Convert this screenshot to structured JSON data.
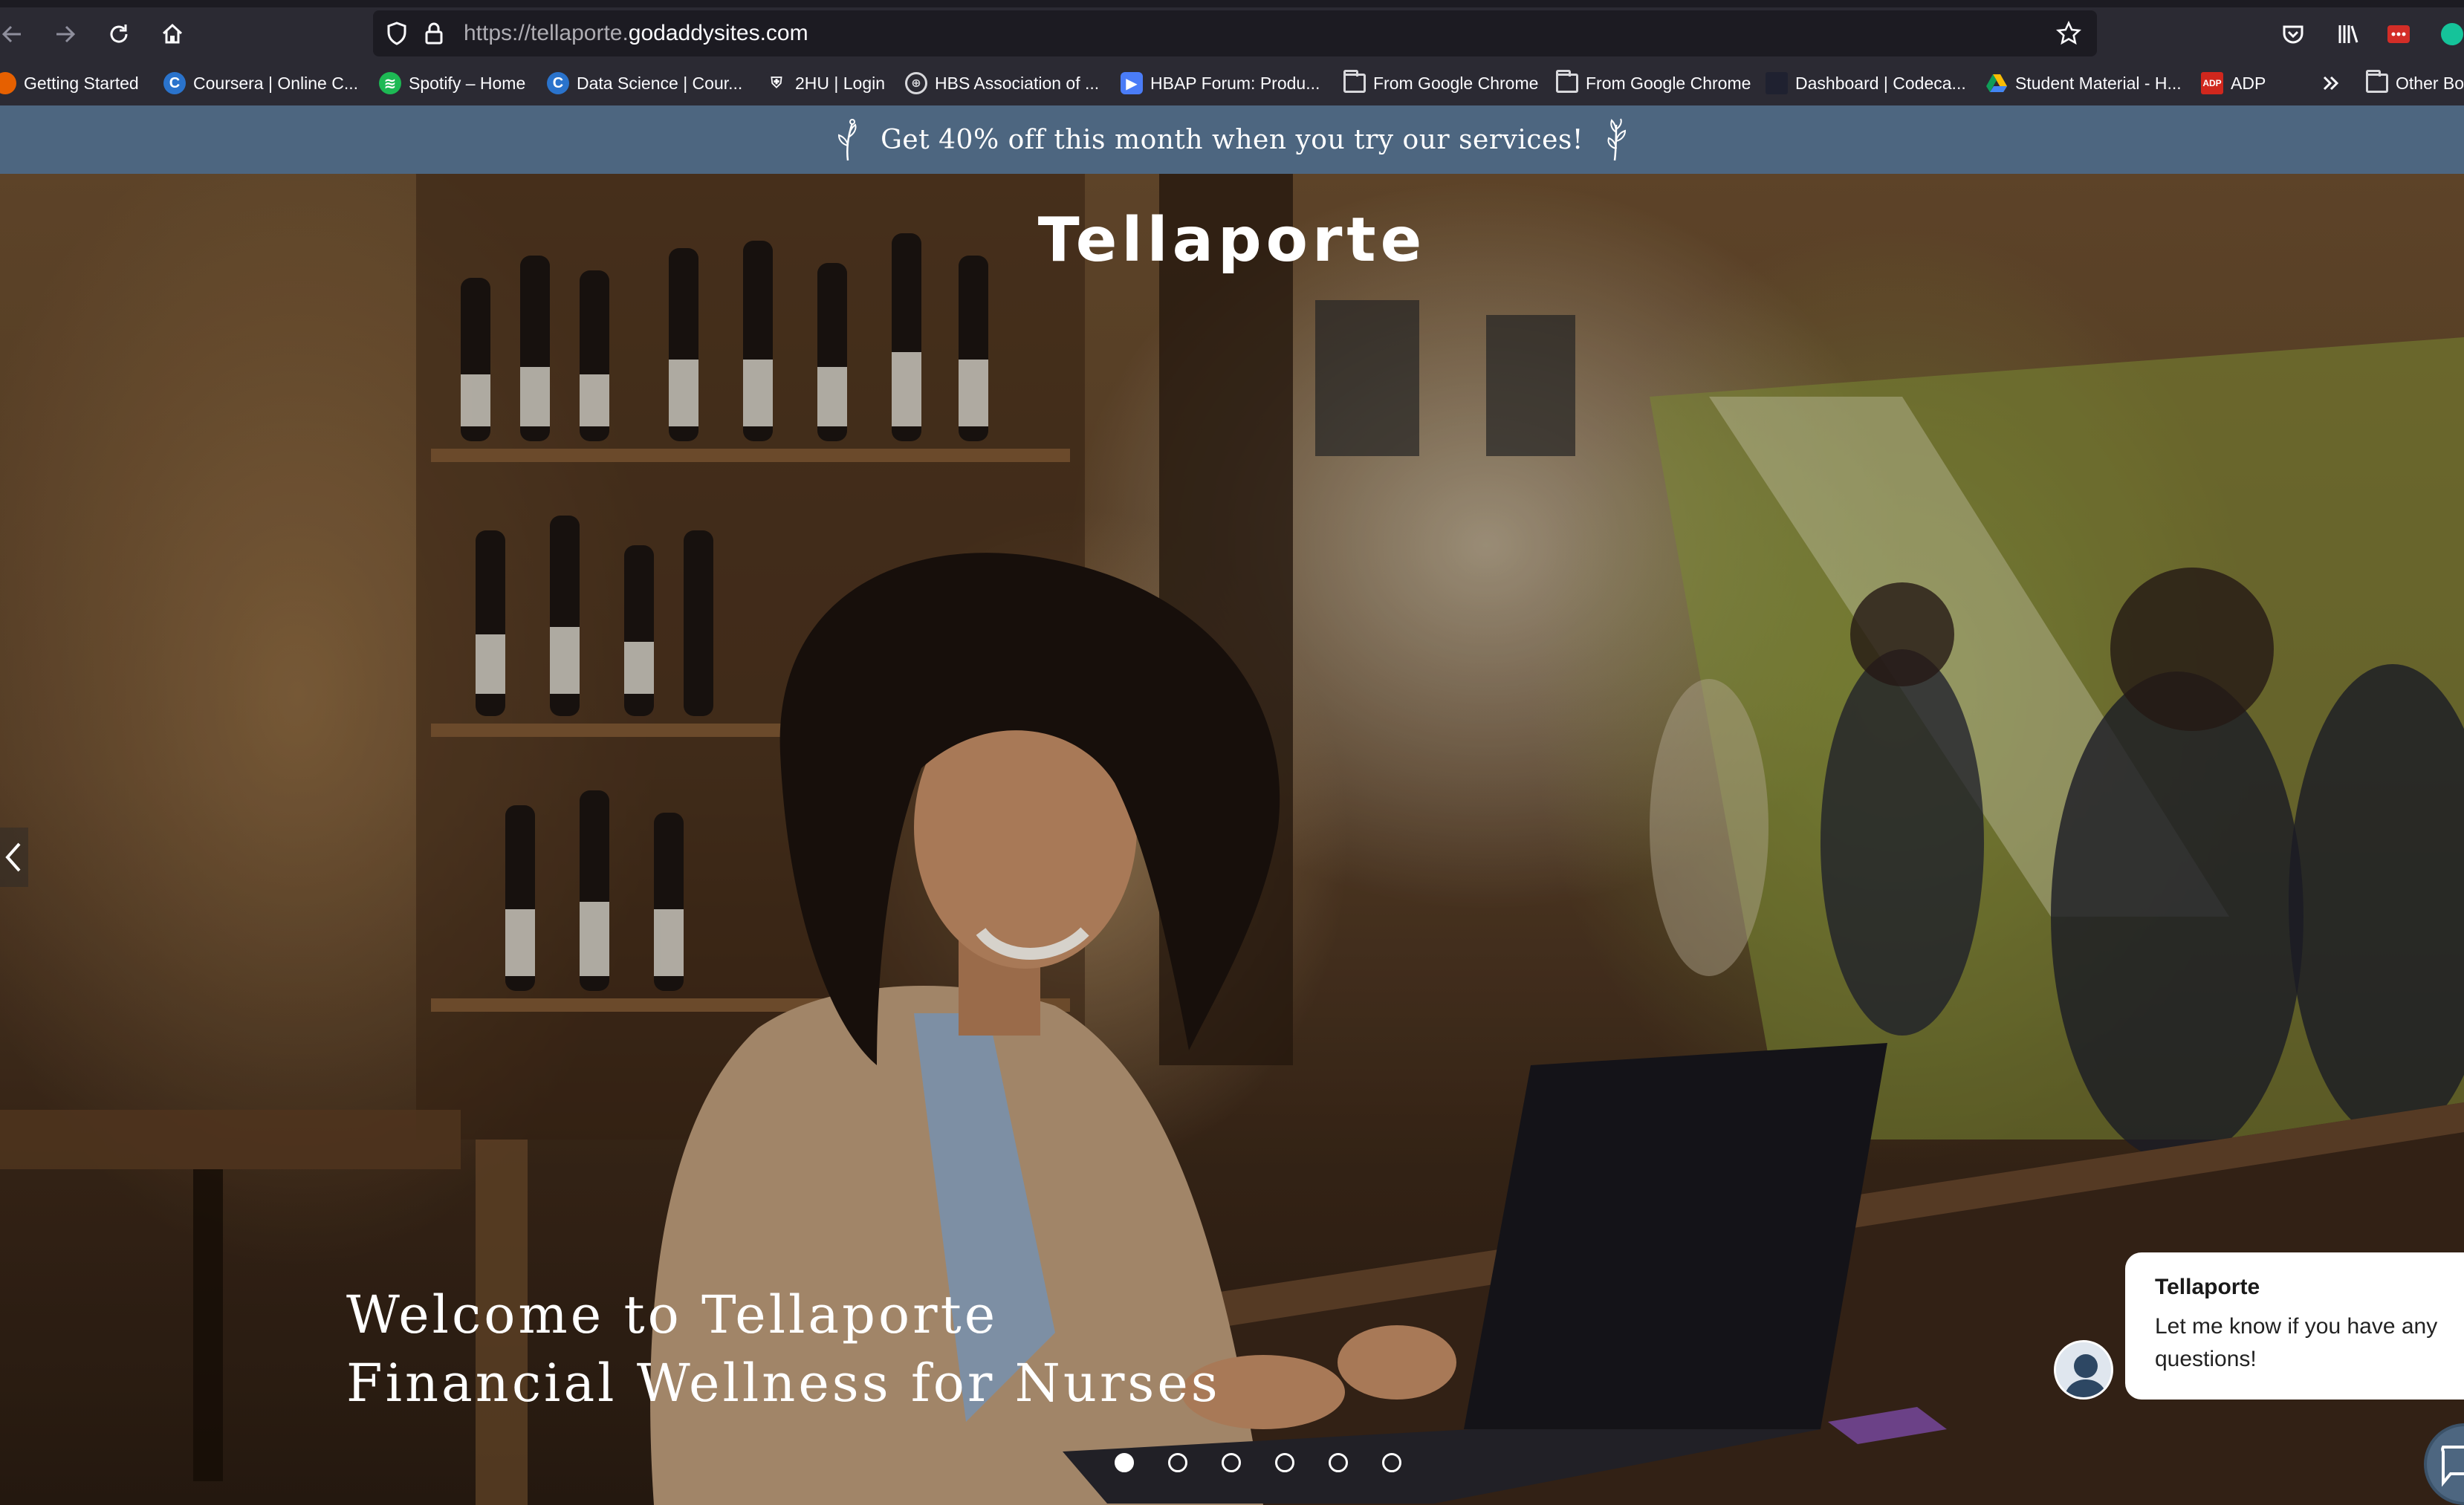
{
  "browser": {
    "url_prefix": "https://tellaporte.",
    "url_domain": "godaddysites.com",
    "bookmarks": [
      {
        "label": "Getting Started",
        "icon": "firefox-icon"
      },
      {
        "label": "Coursera | Online C...",
        "icon": "coursera-icon"
      },
      {
        "label": "Spotify – Home",
        "icon": "spotify-icon"
      },
      {
        "label": "Data Science | Cour...",
        "icon": "coursera-icon"
      },
      {
        "label": "2HU | Login",
        "icon": "harvard-shield-icon"
      },
      {
        "label": "HBS Association of ...",
        "icon": "globe-icon"
      },
      {
        "label": "HBAP Forum: Produ...",
        "icon": "zoom-icon"
      },
      {
        "label": "From Google Chrome",
        "icon": "folder-icon"
      },
      {
        "label": "From Google Chrome",
        "icon": "folder-icon"
      },
      {
        "label": "Dashboard | Codeca...",
        "icon": "codecademy-icon"
      },
      {
        "label": "Student Material - H...",
        "icon": "google-drive-icon"
      },
      {
        "label": "ADP",
        "icon": "adp-icon"
      },
      {
        "label": "Other Bo",
        "icon": "folder-icon"
      }
    ]
  },
  "announcement": {
    "text": "Get 40% off this month when you try our services!"
  },
  "hero": {
    "site_title": "Tellaporte",
    "heading_line1": "Welcome to Tellaporte",
    "heading_line2": "Financial Wellness for Nurses",
    "slide_count": 6,
    "active_slide": 1
  },
  "chat": {
    "name": "Tellaporte",
    "message": "Let me know if you have any questions!"
  },
  "colors": {
    "announcement_bg": "#4d6680",
    "chrome_bg": "#2b2a33",
    "urlbar_bg": "#1c1b22"
  }
}
